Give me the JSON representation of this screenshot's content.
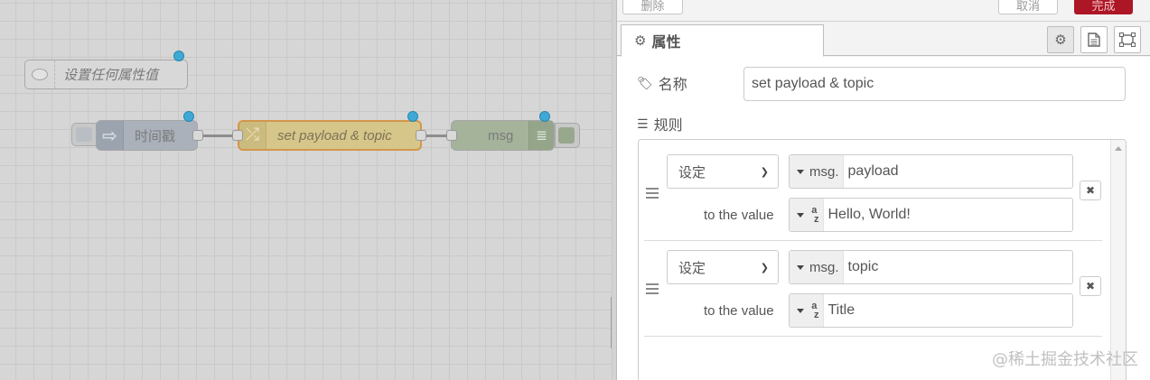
{
  "canvas": {
    "comment_node": {
      "label": "设置任何属性值"
    },
    "inject_node": {
      "label": "时间戳"
    },
    "change_node": {
      "label": "set payload & topic"
    },
    "debug_node": {
      "label": "msg"
    }
  },
  "panel": {
    "topbar": {
      "delete_label": "删除",
      "cancel_label": "取消",
      "done_label": "完成"
    },
    "tabs": {
      "properties_label": "属性",
      "settings_icon": "gear-icon",
      "description_icon": "file-icon",
      "appearance_icon": "frame-icon"
    },
    "name": {
      "label": "名称",
      "value": "set payload & topic"
    },
    "rules": {
      "label": "规则",
      "items": [
        {
          "action": "设定",
          "target_type": "msg.",
          "target": "payload",
          "value_label": "to the value",
          "value_type": "az",
          "value": "Hello, World!"
        },
        {
          "action": "设定",
          "target_type": "msg.",
          "target": "topic",
          "value_label": "to the value",
          "value_type": "az",
          "value": "Title"
        }
      ]
    }
  },
  "colors": {
    "done_button": "#ad1625",
    "change_node": "#d6c68a",
    "selected_border": "#d4964a",
    "changed_indicator": "#3fa9d6"
  },
  "watermark": "@稀土掘金技术社区"
}
